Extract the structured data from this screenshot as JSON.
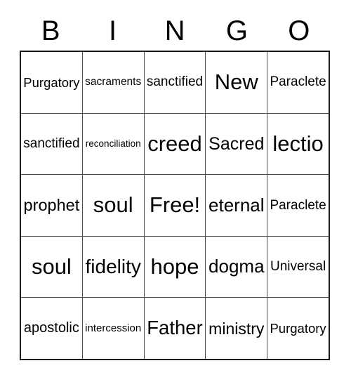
{
  "card": {
    "type": "bingo-card",
    "columns": 5,
    "rows": 5,
    "background_color": "#ffffff",
    "text_color": "#000000",
    "border_color": "#1a1a1a",
    "gridline_color": "#4d4d4d",
    "header": {
      "letters": [
        "B",
        "I",
        "N",
        "G",
        "O"
      ]
    },
    "free_space": {
      "label": "Free!",
      "row": 3,
      "column": 3
    },
    "rows_data": [
      {
        "index": 1,
        "cells": [
          {
            "text": "Purgatory"
          },
          {
            "text": "sacraments"
          },
          {
            "text": "sanctified"
          },
          {
            "text": "New"
          },
          {
            "text": "Paraclete"
          }
        ]
      },
      {
        "index": 2,
        "cells": [
          {
            "text": "sanctified"
          },
          {
            "text": "reconciliation"
          },
          {
            "text": "creed"
          },
          {
            "text": "Sacred"
          },
          {
            "text": "lectio"
          }
        ]
      },
      {
        "index": 3,
        "cells": [
          {
            "text": "prophet"
          },
          {
            "text": "soul"
          },
          {
            "text": "Free!"
          },
          {
            "text": "eternal"
          },
          {
            "text": "Paraclete"
          }
        ]
      },
      {
        "index": 4,
        "cells": [
          {
            "text": "soul"
          },
          {
            "text": "fidelity"
          },
          {
            "text": "hope"
          },
          {
            "text": "dogma"
          },
          {
            "text": "Universal"
          }
        ]
      },
      {
        "index": 5,
        "cells": [
          {
            "text": "apostolic"
          },
          {
            "text": "intercession"
          },
          {
            "text": "Father"
          },
          {
            "text": "ministry"
          },
          {
            "text": "Purgatory"
          }
        ]
      }
    ]
  }
}
